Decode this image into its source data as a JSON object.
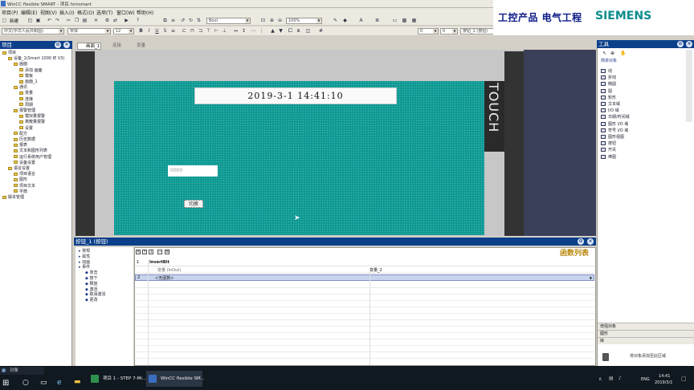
{
  "window": {
    "title": "WinCC flexible SMART - 项目.hmismart"
  },
  "menu": [
    "项目(P)",
    "编辑(E)",
    "视图(V)",
    "插入(I)",
    "格式(O)",
    "选项(T)",
    "窗口(W)",
    "帮助(H)"
  ],
  "toolbar": {
    "new_label": "新建",
    "font_combo": "Bool",
    "zoom_combo": "100%",
    "language_combo": "中文(中华人民共和国)",
    "fontname_combo": "宋体",
    "fontsize_combo": "12",
    "spin1": "0",
    "spin2": "0",
    "object_combo": "按钮_1 (按钮)"
  },
  "brand": {
    "cn_text": "工控产品  电气工程",
    "siemens": "SIEMENS"
  },
  "project_panel": {
    "title": "项目",
    "items": [
      {
        "label": "项目",
        "level": 0
      },
      {
        "label": "设备_1(Smart 1000 IE V3)",
        "level": 1
      },
      {
        "label": "画面",
        "level": 2
      },
      {
        "label": "添加 画面",
        "level": 3
      },
      {
        "label": "模板",
        "level": 3
      },
      {
        "label": "画面_1",
        "level": 3
      },
      {
        "label": "通讯",
        "level": 2
      },
      {
        "label": "变量",
        "level": 3
      },
      {
        "label": "连接",
        "level": 3
      },
      {
        "label": "周期",
        "level": 3
      },
      {
        "label": "报警管理",
        "level": 2
      },
      {
        "label": "模拟量报警",
        "level": 3
      },
      {
        "label": "离散量报警",
        "level": 3
      },
      {
        "label": "设置",
        "level": 3
      },
      {
        "label": "配方",
        "level": 2
      },
      {
        "label": "历史数据",
        "level": 2
      },
      {
        "label": "报表",
        "level": 2
      },
      {
        "label": "文本和图形列表",
        "level": 2
      },
      {
        "label": "运行系统用户管理",
        "level": 2
      },
      {
        "label": "设备设置",
        "level": 2
      },
      {
        "label": "语言设置",
        "level": 1
      },
      {
        "label": "项目语言",
        "level": 2
      },
      {
        "label": "图形",
        "level": 2
      },
      {
        "label": "项目文本",
        "level": 2
      },
      {
        "label": "字典",
        "level": 2
      },
      {
        "label": "版本管理",
        "level": 0
      }
    ]
  },
  "editor": {
    "tabs": [
      "画面_1",
      "连接",
      "变量"
    ],
    "touch_label": "TOUCH",
    "datetime": "2019-3-1  14:41:10",
    "io_field_value": "0000",
    "button_label": "切换"
  },
  "props": {
    "title": "按钮_1 (按钮)",
    "function_list_title": "函数列表",
    "nav": [
      {
        "label": "常规",
        "level": 0
      },
      {
        "label": "属性",
        "level": 0
      },
      {
        "label": "动画",
        "level": 0
      },
      {
        "label": "事件",
        "level": 0
      },
      {
        "label": "单击",
        "level": 1
      },
      {
        "label": "按下",
        "level": 1
      },
      {
        "label": "释放",
        "level": 1
      },
      {
        "label": "激活",
        "level": 1
      },
      {
        "label": "取消激活",
        "level": 1
      },
      {
        "label": "更改",
        "level": 1
      }
    ],
    "rows": [
      {
        "num": "1",
        "name": "InvertBit",
        "value": ""
      },
      {
        "num": "",
        "name": "变量 (InOut)",
        "value": "变量_2"
      },
      {
        "num": "2",
        "name": "<无函数>",
        "value": ""
      }
    ]
  },
  "toolbox": {
    "title": "工具",
    "section": "简单对象",
    "items": [
      "线",
      "折线",
      "椭圆",
      "圆",
      "矩形",
      "文本域",
      "I/O 域",
      "日期/时间域",
      "图形 I/O 域",
      "符号 I/O 域",
      "图形视图",
      "按钮",
      "开关",
      "棒图"
    ],
    "bottom_sections": [
      "增强对象",
      "图形",
      "库"
    ],
    "hint": "将对象添加至此区域"
  },
  "taskbar": {
    "search": "对象",
    "tasks": [
      "项目 1 - STEP 7-Mi...",
      "WinCC flexible SM..."
    ],
    "lang": "ENG",
    "time": "14:41",
    "date": "2019/3/1"
  }
}
